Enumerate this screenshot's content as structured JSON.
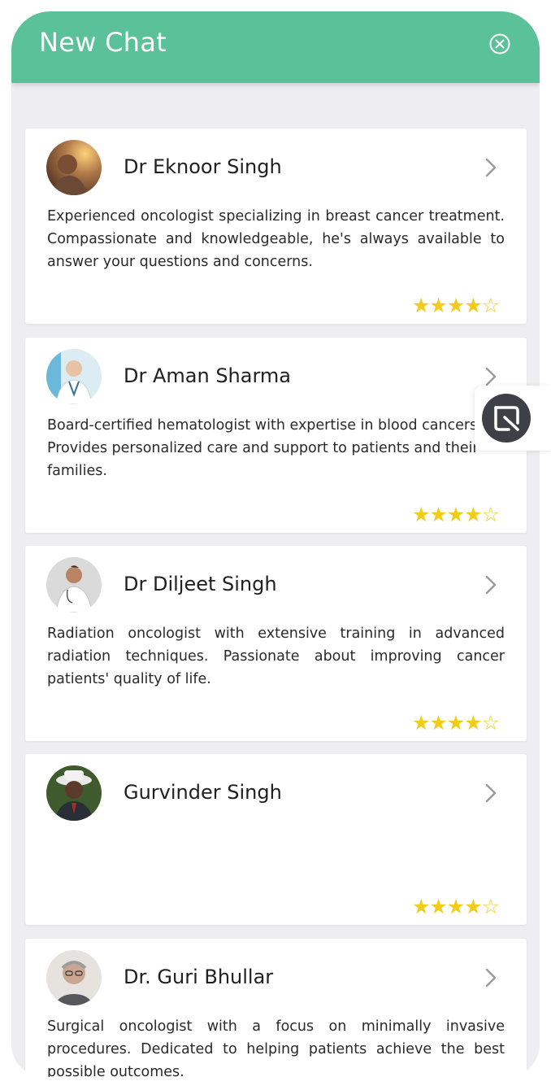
{
  "header": {
    "title": "New Chat",
    "close_icon": "close-circle-icon"
  },
  "accent_color": "#5bc198",
  "star_color": "#f2cc19",
  "doctors": [
    {
      "name": "Dr Eknoor Singh",
      "description": "Experienced oncologist specializing in breast cancer treatment. Compassionate and knowledgeable, he's always available to answer your questions and concerns.",
      "rating": 4,
      "rating_display": "★★★★☆"
    },
    {
      "name": "Dr Aman Sharma",
      "description": "Board-certified hematologist with expertise in blood cancers. Provides personalized care and support to patients and their families.",
      "rating": 4,
      "rating_display": "★★★★☆"
    },
    {
      "name": "Dr Diljeet Singh",
      "description": "Radiation oncologist with extensive training in advanced radiation techniques. Passionate about improving cancer patients' quality of life.",
      "rating": 4,
      "rating_display": "★★★★☆"
    },
    {
      "name": "Gurvinder Singh",
      "description": "",
      "rating": 4,
      "rating_display": "★★★★☆"
    },
    {
      "name": "Dr. Guri Bhullar",
      "description": "Surgical oncologist with a focus on minimally invasive procedures. Dedicated to helping patients achieve the best possible outcomes.",
      "rating": null,
      "rating_display": ""
    }
  ],
  "floating_button": {
    "icon": "app-logo-icon"
  }
}
